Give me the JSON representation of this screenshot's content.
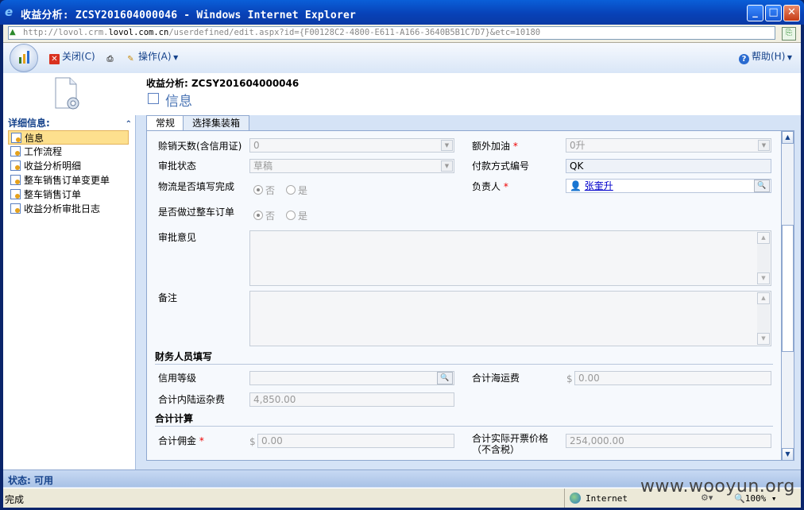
{
  "window": {
    "title": "收益分析: ZCSY201604000046 - Windows Internet Explorer"
  },
  "address": {
    "prefix": "http://lovol.crm.",
    "host": "lovol.com.cn",
    "path": "/userdefined/edit.aspx?id={F00128C2-4800-E611-A166-3640B5B1C7D7}&etc=10180"
  },
  "toolbar": {
    "close_label": "关闭(C)",
    "operations_label": "操作(A)",
    "help_label": "帮助(H)"
  },
  "sidebar": {
    "header": "详细信息:",
    "items": [
      {
        "label": "信息",
        "selected": true
      },
      {
        "label": "工作流程",
        "selected": false
      },
      {
        "label": "收益分析明细",
        "selected": false
      },
      {
        "label": "整车销售订单变更单",
        "selected": false
      },
      {
        "label": "整车销售订单",
        "selected": false
      },
      {
        "label": "收益分析审批日志",
        "selected": false
      }
    ]
  },
  "header": {
    "record_title": "收益分析: ZCSY201604000046",
    "section_title": "信息"
  },
  "tabs": [
    {
      "label": "常规",
      "active": true
    },
    {
      "label": "选择集装箱",
      "active": false
    }
  ],
  "form": {
    "credit_days": {
      "label": "赊销天数(含信用证)",
      "value": "0"
    },
    "extra_fuel": {
      "label": "额外加油",
      "value": "0升"
    },
    "approval_status": {
      "label": "审批状态",
      "value": "草稿"
    },
    "payment_code": {
      "label": "付款方式编号",
      "value": "QK"
    },
    "logistics_filled": {
      "label": "物流是否填写完成",
      "opt_no": "否",
      "opt_yes": "是"
    },
    "owner": {
      "label": "负责人",
      "value": "张奎升"
    },
    "vehicle_order": {
      "label": "是否做过整车订单",
      "opt_no": "否",
      "opt_yes": "是"
    },
    "approval_opinion": {
      "label": "审批意见"
    },
    "remarks": {
      "label": "备注"
    },
    "finance_section": "财务人员填写",
    "credit_level": {
      "label": "信用等级"
    },
    "total_sea_freight": {
      "label": "合计海运费",
      "currency": "$",
      "value": "0.00"
    },
    "total_inland_freight": {
      "label": "合计内陆运杂费",
      "value": "4,850.00"
    },
    "totals_section": "合计计算",
    "total_commission": {
      "label": "合计佣金",
      "currency": "$",
      "value": "0.00"
    },
    "actual_invoice_price": {
      "label_line1": "合计实际开票价格",
      "label_line2": "（不含税）",
      "value": "254,000.00"
    }
  },
  "status": {
    "app_status": "状态: 可用",
    "ie_status": "完成",
    "zone": "Internet",
    "zoom": "100%"
  },
  "watermark": "www.wooyun.org",
  "colors": {
    "title_bar": "#0a4fc8",
    "selected_nav": "#fde08e",
    "required": "#e00000",
    "link": "#0000cc"
  }
}
